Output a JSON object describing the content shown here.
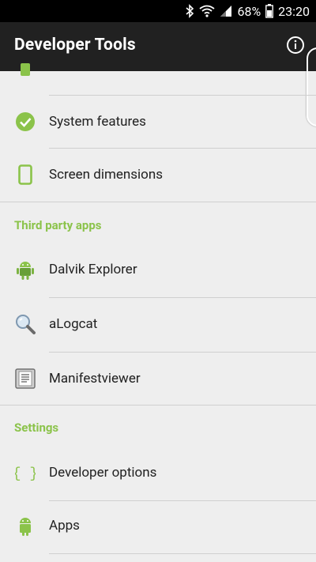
{
  "status_bar": {
    "battery": "68%",
    "time": "23:20",
    "icons": [
      "bluetooth-icon",
      "wifi-icon",
      "signal-icon",
      "battery-icon"
    ]
  },
  "toolbar": {
    "title": "Developer Tools",
    "info_icon": "info-icon"
  },
  "list": {
    "items": [
      {
        "label": "System features",
        "icon": "check-circle-icon"
      },
      {
        "label": "Screen dimensions",
        "icon": "phone-icon"
      }
    ],
    "sections": [
      {
        "title": "Third party apps",
        "items": [
          {
            "label": "Dalvik Explorer",
            "icon": "android-icon"
          },
          {
            "label": "aLogcat",
            "icon": "magnifier-icon"
          },
          {
            "label": "Manifestviewer",
            "icon": "document-icon"
          }
        ]
      },
      {
        "title": "Settings",
        "items": [
          {
            "label": "Developer options",
            "icon": "braces-icon"
          },
          {
            "label": "Apps",
            "icon": "android-outline-icon"
          }
        ]
      }
    ]
  },
  "colors": {
    "accent": "#8bc34a",
    "toolbar": "#212121",
    "background": "#eeeeee"
  }
}
